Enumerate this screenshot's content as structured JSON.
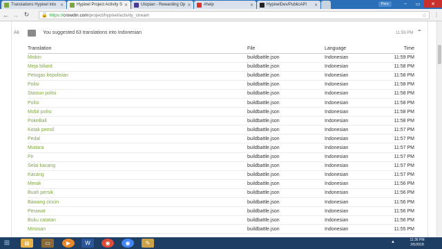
{
  "browser": {
    "tabs": [
      {
        "label": "Translations Hypixel into",
        "icon": "crowdin-icon",
        "color": "#7ea640"
      },
      {
        "label": "Hypixel Project Activity S",
        "icon": "crowdin-icon",
        "color": "#7ea640"
      },
      {
        "label": "Utopian - Rewarding Op",
        "icon": "utopian-icon",
        "color": "#4b3b8f"
      },
      {
        "label": "#help",
        "icon": "chat-icon",
        "color": "#d9342b"
      },
      {
        "label": "HypixelDev/PublicAPI",
        "icon": "github-icon",
        "color": "#222222"
      }
    ],
    "user_badge": "Peru",
    "url_scheme": "https://",
    "url_host": "crowdin.com",
    "url_path": "/project/hypixel/activity_stream"
  },
  "activity": {
    "user_initials": "Ak",
    "summary": "You suggested 63 translations into Indonesian",
    "time": "11:59 PM",
    "columns": {
      "translation": "Translation",
      "file": "File",
      "language": "Language",
      "time": "Time"
    },
    "rows": [
      [
        "Miskin",
        "buildbattle.json",
        "Indonesian",
        "11:59 PM"
      ],
      [
        "Meja biliard",
        "buildbattle.json",
        "Indonesian",
        "11:58 PM"
      ],
      [
        "Petugas kepolisian",
        "buildbattle.json",
        "Indonesian",
        "11:58 PM"
      ],
      [
        "Polisi",
        "buildbattle.json",
        "Indonesian",
        "11:58 PM"
      ],
      [
        "Stasiun polisi",
        "buildbattle.json",
        "Indonesian",
        "11:58 PM"
      ],
      [
        "Polisi",
        "buildbattle.json",
        "Indonesian",
        "11:58 PM"
      ],
      [
        "Mobil polisi",
        "buildbattle.json",
        "Indonesian",
        "11:58 PM"
      ],
      [
        "PokeBall",
        "buildbattle.json",
        "Indonesian",
        "11:58 PM"
      ],
      [
        "Kotak pensil",
        "buildbattle.json",
        "Indonesian",
        "11:57 PM"
      ],
      [
        "Pedal",
        "buildbattle.json",
        "Indonesian",
        "11:57 PM"
      ],
      [
        "Mutiara",
        "buildbattle.json",
        "Indonesian",
        "11:57 PM"
      ],
      [
        "Pir",
        "buildbattle.json",
        "Indonesian",
        "11:57 PM"
      ],
      [
        "Selai kacang",
        "buildbattle.json",
        "Indonesian",
        "11:57 PM"
      ],
      [
        "Kacang",
        "buildbattle.json",
        "Indonesian",
        "11:57 PM"
      ],
      [
        "Merak",
        "buildbattle.json",
        "Indonesian",
        "11:56 PM"
      ],
      [
        "Buah persik",
        "buildbattle.json",
        "Indonesian",
        "11:56 PM"
      ],
      [
        "Bawang cincin",
        "buildbattle.json",
        "Indonesian",
        "11:56 PM"
      ],
      [
        "Perawat",
        "buildbattle.json",
        "Indonesian",
        "11:56 PM"
      ],
      [
        "Buku catatan",
        "buildbattle.json",
        "Indonesian",
        "11:56 PM"
      ],
      [
        "Mimisan",
        "buildbattle.json",
        "Indonesian",
        "11:55 PM"
      ]
    ]
  },
  "taskbar": {
    "apps": [
      {
        "name": "windows-explorer-icon",
        "color": "#e8b44a"
      },
      {
        "name": "media-player-icon",
        "color": "#e8862a"
      },
      {
        "name": "word-icon",
        "color": "#2b579a"
      },
      {
        "name": "chrome-icon",
        "color": "#dd4b39"
      },
      {
        "name": "chrome-icon",
        "color": "#4285f4"
      },
      {
        "name": "paint-icon",
        "color": "#c9a24a"
      }
    ],
    "clock_time": "11:36 PM",
    "clock_date": "2/5/2018",
    "accent": "#1e3e63"
  }
}
